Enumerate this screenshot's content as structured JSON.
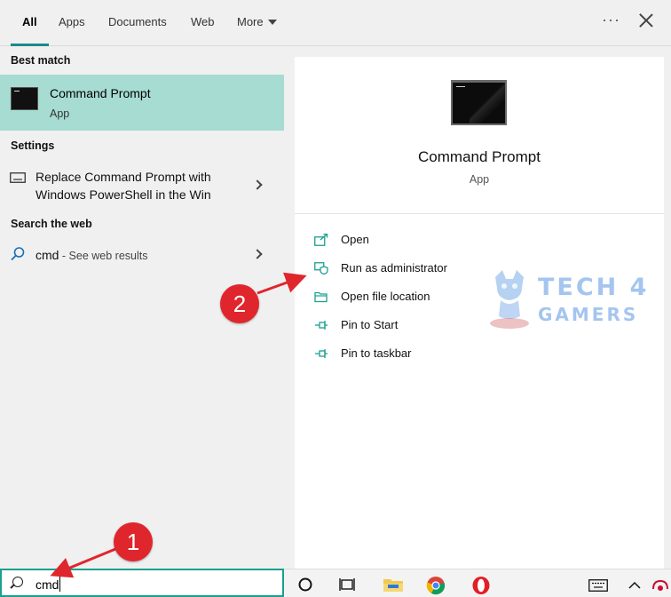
{
  "tabs": [
    {
      "label": "All",
      "active": true
    },
    {
      "label": "Apps"
    },
    {
      "label": "Documents"
    },
    {
      "label": "Web"
    },
    {
      "label": "More"
    }
  ],
  "header": {
    "more_icon": "ellipsis-icon",
    "close_icon": "close-icon"
  },
  "results": {
    "best_match_heading": "Best match",
    "best_match": {
      "title": "Command Prompt",
      "subtitle": "App",
      "icon": "command-prompt-icon"
    },
    "settings_heading": "Settings",
    "settings_item": {
      "line1": "Replace Command Prompt with",
      "line2": "Windows PowerShell in the Win",
      "icon": "keyboard-icon"
    },
    "web_heading": "Search the web",
    "web_item": {
      "query": "cmd",
      "suffix": " - See web results",
      "icon": "search-icon"
    }
  },
  "detail": {
    "title": "Command Prompt",
    "subtitle": "App",
    "actions": [
      {
        "label": "Open",
        "icon": "open-icon"
      },
      {
        "label": "Run as administrator",
        "icon": "run-as-admin-icon"
      },
      {
        "label": "Open file location",
        "icon": "file-location-icon"
      },
      {
        "label": "Pin to Start",
        "icon": "pin-icon"
      },
      {
        "label": "Pin to taskbar",
        "icon": "pin-icon"
      }
    ]
  },
  "search": {
    "value": "cmd",
    "icon": "search-icon"
  },
  "annotations": {
    "step1": "1",
    "step2": "2"
  },
  "watermark": {
    "line1": "TECH 4",
    "line2": "GAMERS"
  },
  "colors": {
    "accent": "#1c8a8a",
    "selection": "#a6dcd2",
    "annotation": "#e0262d"
  },
  "taskbar": {
    "icons": [
      "cortana-circle-icon",
      "task-view-icon",
      "file-explorer-icon",
      "chrome-icon",
      "opera-icon",
      "keyboard-icon",
      "chevron-up-icon",
      "tray-app-icon"
    ]
  }
}
